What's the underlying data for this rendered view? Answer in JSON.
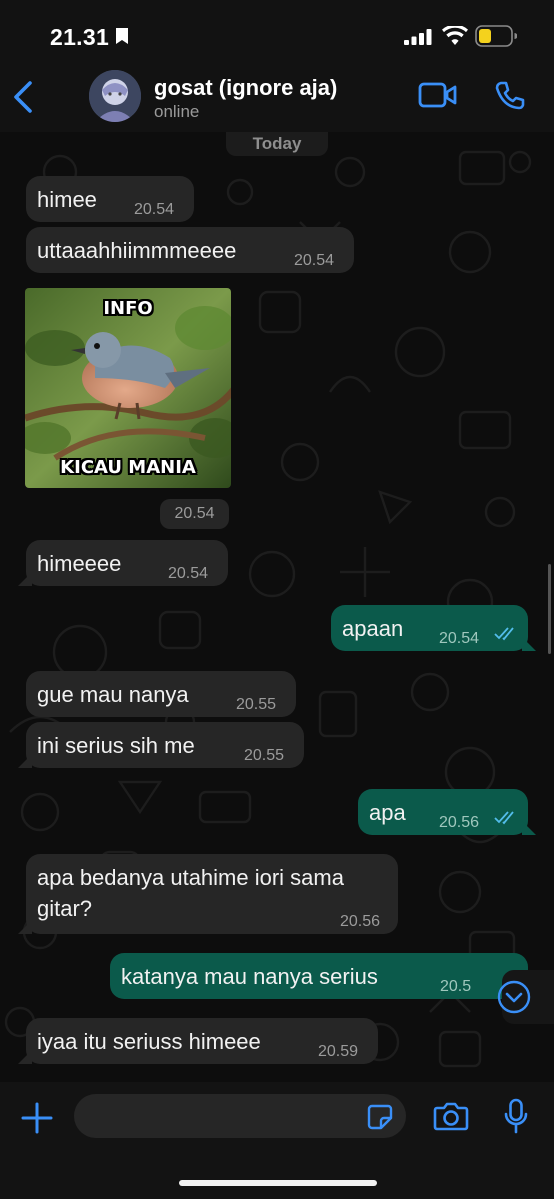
{
  "status_bar": {
    "time": "21.31"
  },
  "header": {
    "contact_name": "gosat (ignore aja)",
    "contact_status": "online"
  },
  "chat": {
    "date_divider": "Today",
    "messages": [
      {
        "dir": "in",
        "text": "himee",
        "time": "20.54"
      },
      {
        "dir": "in",
        "text": "uttaaahhiimmmeeee",
        "time": "20.54"
      },
      {
        "dir": "in",
        "type": "sticker",
        "caption_top": "INFO",
        "caption_bottom": "KICAU MANIA",
        "time": "20.54"
      },
      {
        "dir": "in",
        "text": "himeeee",
        "time": "20.54"
      },
      {
        "dir": "out",
        "text": "apaan",
        "time": "20.54",
        "read": true
      },
      {
        "dir": "in",
        "text": "gue mau nanya",
        "time": "20.55"
      },
      {
        "dir": "in",
        "text": "ini serius sih me",
        "time": "20.55"
      },
      {
        "dir": "out",
        "text": "apa",
        "time": "20.56",
        "read": true
      },
      {
        "dir": "in",
        "text_line1": "apa bedanya utahime iori sama",
        "text_line2": "gitar?",
        "time": "20.56"
      },
      {
        "dir": "out",
        "text": "katanya mau nanya serius",
        "time": "20.5"
      },
      {
        "dir": "in",
        "text": "iyaa itu seriuss himeee",
        "time": "20.59"
      }
    ]
  },
  "compose": {
    "placeholder": ""
  },
  "colors": {
    "accent": "#3a8ff7",
    "outgoing_bubble": "#0b5a4b",
    "incoming_bubble": "#262626",
    "read_ticks": "#53bdeb",
    "battery": "#f4d21d"
  },
  "icons": [
    "bookmark-icon",
    "signal-icon",
    "wifi-icon",
    "battery-icon",
    "back-icon",
    "video-call-icon",
    "phone-icon",
    "chevron-down-icon",
    "plus-icon",
    "sticker-icon",
    "camera-icon",
    "microphone-icon",
    "double-check-icon"
  ]
}
